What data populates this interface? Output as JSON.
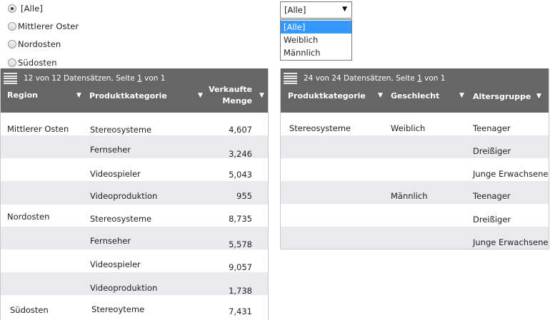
{
  "radio_group": {
    "options": [
      {
        "label": "[Alle]",
        "checked": true
      },
      {
        "label": "Mittlerer Oster",
        "checked": false
      },
      {
        "label": "Nordosten",
        "checked": false
      },
      {
        "label": "Südosten",
        "checked": false
      }
    ]
  },
  "gender_select": {
    "value": "[Alle]",
    "options": [
      "[Alle]",
      "Weiblich",
      "Männlich"
    ],
    "selected_index": 0
  },
  "grid1": {
    "pager": {
      "count": "12 von 12",
      "text": "Datensätzen, Seite",
      "page": "1",
      "of": "von 1"
    },
    "columns": {
      "region": "Region",
      "category": "Produktkategorie",
      "qty_line1": "Verkaufte",
      "qty_line2": "Menge"
    },
    "rows": [
      {
        "region": "Mittlerer Osten",
        "category": "Stereosysteme",
        "qty": "4,607"
      },
      {
        "region": "",
        "category": "Fernseher",
        "qty": "3,246"
      },
      {
        "region": "",
        "category": "Videospieler",
        "qty": "5,043"
      },
      {
        "region": "",
        "category": "Videoproduktion",
        "qty": "955"
      },
      {
        "region": "Nordosten",
        "category": "Stereosysteme",
        "qty": "8,735"
      },
      {
        "region": "",
        "category": "Fernseher",
        "qty": "5,578"
      },
      {
        "region": "",
        "category": "Videospieler",
        "qty": "9,057"
      },
      {
        "region": "",
        "category": "Videoproduktion",
        "qty": "1,738"
      },
      {
        "region": "Südosten",
        "category": "Stereoyteme",
        "qty": "7,431"
      }
    ]
  },
  "grid2": {
    "pager": {
      "count": "24 von  24",
      "text": "Datensätzen, Seite",
      "page": "1",
      "of": "von 1"
    },
    "columns": {
      "category": "Produktkategorie",
      "gender": "Geschlecht",
      "age": "Altersgruppe"
    },
    "rows": [
      {
        "category": "Stereosysteme",
        "gender": "Weiblich",
        "age": "Teenager"
      },
      {
        "category": "",
        "gender": "",
        "age": "Dreißiger"
      },
      {
        "category": "",
        "gender": "",
        "age": "Junge Erwachsene"
      },
      {
        "category": "",
        "gender": "Männlich",
        "age": "Teenager"
      },
      {
        "category": "",
        "gender": "",
        "age": "Dreißiger"
      },
      {
        "category": "",
        "gender": "",
        "age": "Junge Erwachsene"
      }
    ]
  },
  "colors": {
    "header_bg": "#666666",
    "alt_row": "#e9e9ee",
    "selected_option": "#3399ff"
  }
}
